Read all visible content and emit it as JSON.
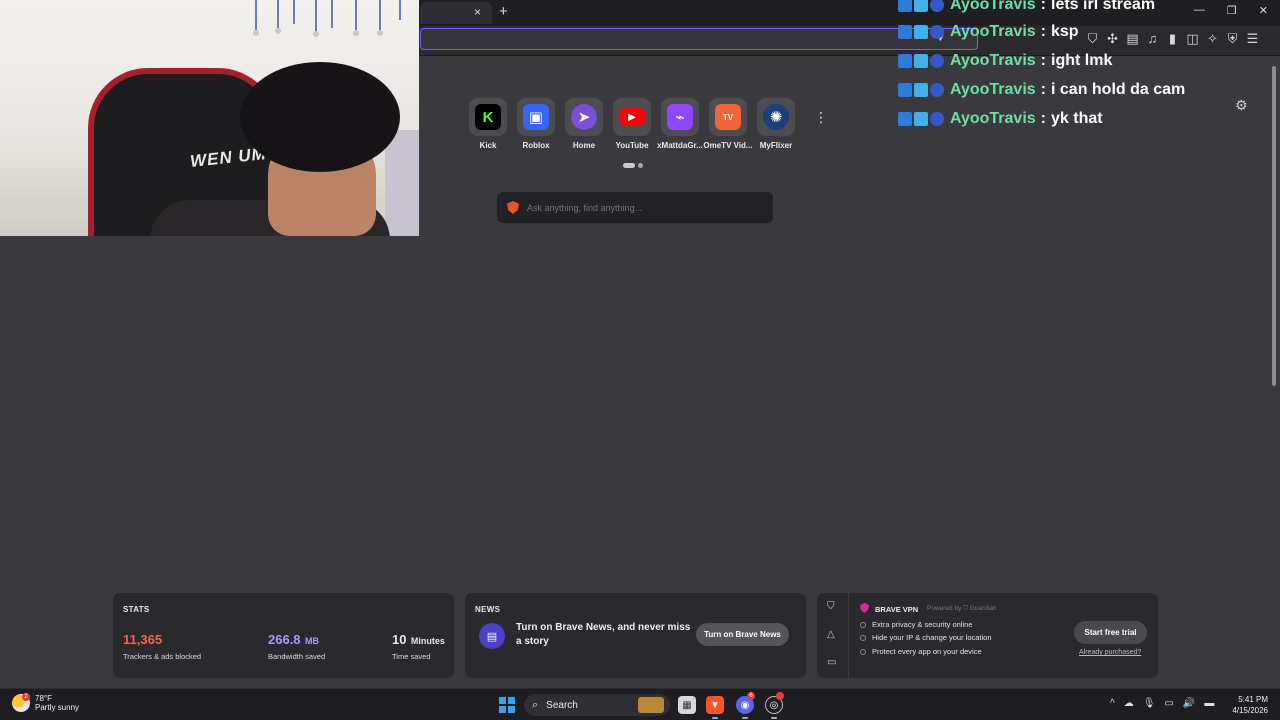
{
  "browser": {
    "tab_close": "×",
    "new_tab": "+",
    "window_controls": [
      "—",
      "❐",
      "✕"
    ],
    "toolbar_icons": [
      "shield-icon",
      "extensions-icon",
      "wallet-icon",
      "media-icon",
      "sidebar-icon",
      "wallet-panel-icon",
      "leo-icon",
      "vpn-icon",
      "menu-icon"
    ]
  },
  "webcam": {
    "chair_text": "WEN UM"
  },
  "chat": [
    {
      "user": "AyooTravis",
      "message": "lets irl stream"
    },
    {
      "user": "AyooTravis",
      "message": "ksp"
    },
    {
      "user": "AyooTravis",
      "message": "ight lmk"
    },
    {
      "user": "AyooTravis",
      "message": "i can hold da cam"
    },
    {
      "user": "AyooTravis",
      "message": "yk that"
    }
  ],
  "top_sites": [
    {
      "label": "Kick",
      "glyph": "K",
      "color": "#53fc18"
    },
    {
      "label": "Roblox",
      "glyph": "▣",
      "color": "#3b64f3"
    },
    {
      "label": "Home",
      "glyph": "➤",
      "color": "#7b4fd6"
    },
    {
      "label": "YouTube",
      "glyph": "▶",
      "color": "#ff0000"
    },
    {
      "label": "xMattdaGr...",
      "glyph": "⌁",
      "color": "#9146ff"
    },
    {
      "label": "OmeTV Vid...",
      "glyph": "TV",
      "color": "#f0643c"
    },
    {
      "label": "MyFlixer",
      "glyph": "✺",
      "color": "#1d3f7a"
    }
  ],
  "search": {
    "placeholder": "Ask anything, find anything..."
  },
  "stats": {
    "title": "STATS",
    "trackers_value": "11,365",
    "trackers_label": "Trackers & ads blocked",
    "trackers_color": "#f5684f",
    "bandwidth_value": "266.8",
    "bandwidth_unit": "MB",
    "bandwidth_label": "Bandwidth saved",
    "bandwidth_color": "#a89bff",
    "time_value": "10",
    "time_unit": "Minutes",
    "time_label": "Time saved"
  },
  "news": {
    "title": "NEWS",
    "text": "Turn on Brave News, and never miss a story",
    "button": "Turn on Brave News"
  },
  "vpn": {
    "title": "BRAVE VPN",
    "powered": "Powered by ⛉ Guardian",
    "features": [
      "Extra privacy & security online",
      "Hide your IP & change your location",
      "Protect every app on your device"
    ],
    "button": "Start free trial",
    "link": "Already purchased?"
  },
  "taskbar": {
    "weather_temp": "78°F",
    "weather_desc": "Partly sunny",
    "weather_badge": "2",
    "search_label": "Search",
    "discord_badge": "6",
    "time": "5:41 PM",
    "date": "4/15/2026"
  }
}
